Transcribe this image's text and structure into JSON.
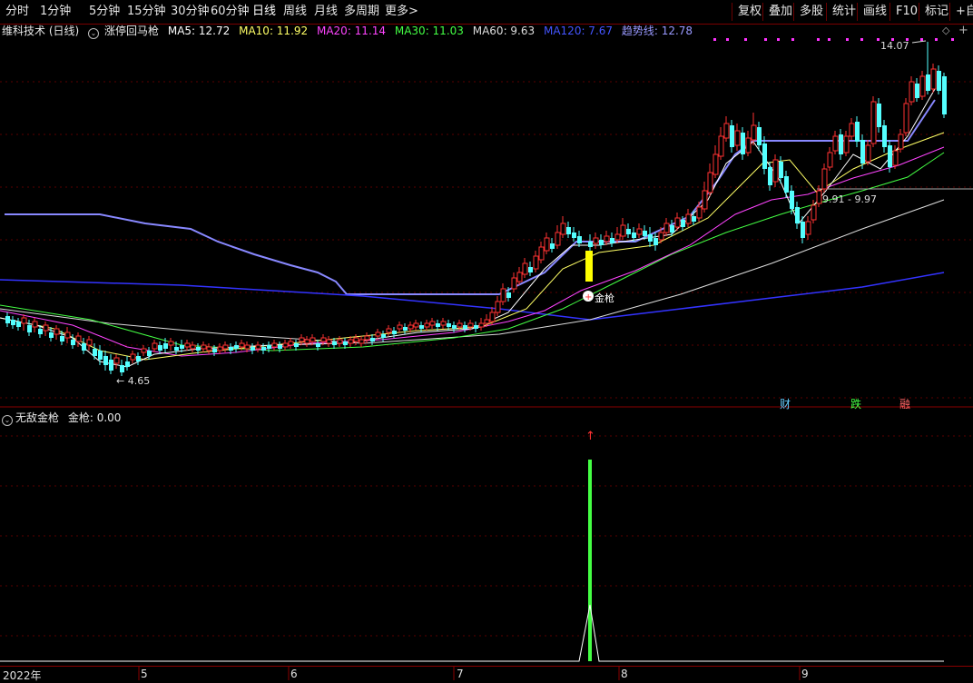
{
  "toolbar": {
    "periods": [
      "分时",
      "1分钟",
      "5分钟",
      "15分钟",
      "30分钟",
      "60分钟",
      "日线",
      "周线",
      "月线",
      "多周期",
      "更多"
    ],
    "active": "日线",
    "right": [
      "复权",
      "叠加",
      "多股",
      "统计",
      "画线",
      "F10",
      "标记",
      "+自"
    ]
  },
  "legend": {
    "stock": "维科技术 (日线)",
    "indicator": "涨停回马枪",
    "items": [
      {
        "text": "MA5: 12.72",
        "color": "#ffffff"
      },
      {
        "text": "MA10: 11.92",
        "color": "#ffff66"
      },
      {
        "text": "MA20: 11.14",
        "color": "#ff44ff"
      },
      {
        "text": "MA30: 11.03",
        "color": "#44ff44"
      },
      {
        "text": "MA60: 9.63",
        "color": "#dddddd"
      },
      {
        "text": "MA120: 7.67",
        "color": "#3344ff"
      },
      {
        "text": "趋势线: 12.78",
        "color": "#9999ff"
      }
    ]
  },
  "annotations": {
    "high": "14.07",
    "low": "4.65",
    "range": "9.91 - 9.97",
    "signal": "金枪"
  },
  "tags": [
    {
      "text": "财",
      "color": "#66ccff"
    },
    {
      "text": "跌",
      "color": "#44ff44"
    },
    {
      "text": "融",
      "color": "#ff6666"
    }
  ],
  "sub": {
    "name": "无敌金枪",
    "value": "金枪: 0.00"
  },
  "dates": [
    "2022年",
    "5",
    "6",
    "7",
    "8",
    "9"
  ],
  "colors": {
    "up": "#ff3232",
    "down": "#54ffff",
    "border": "#8a0000",
    "signal": "#44ff44",
    "trend": "#8888ff"
  }
}
